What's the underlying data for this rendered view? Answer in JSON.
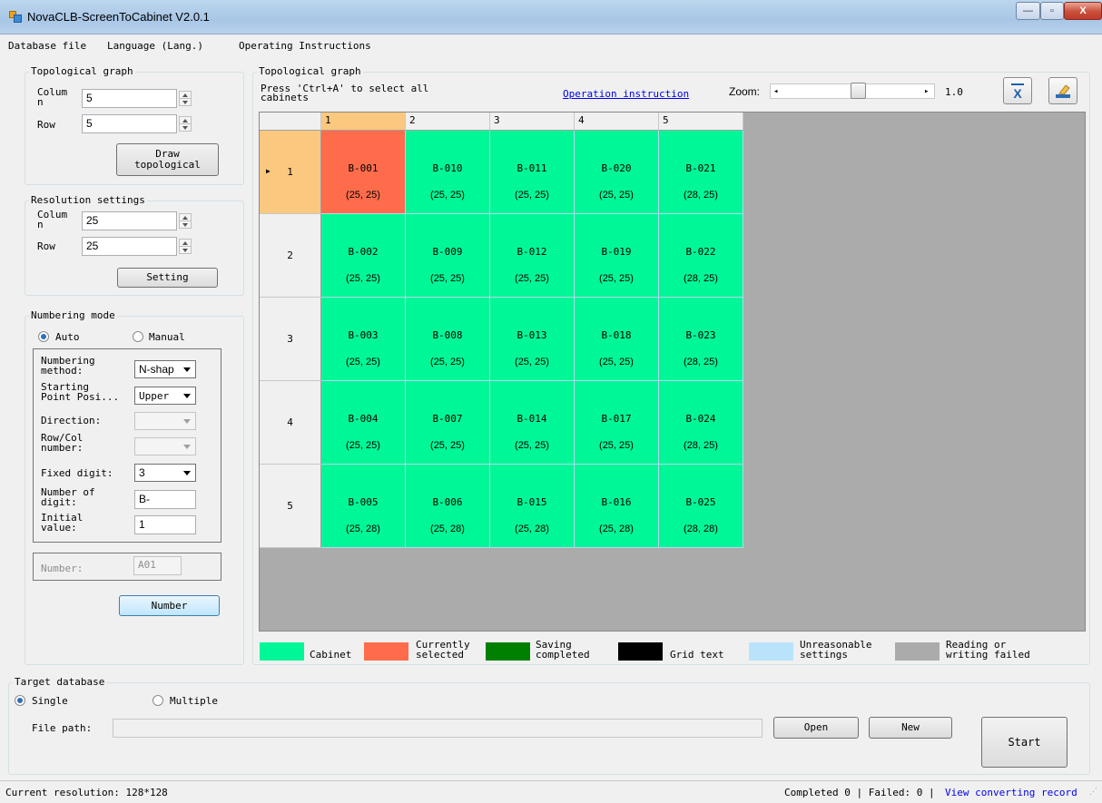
{
  "window": {
    "title": "NovaCLB-ScreenToCabinet V2.0.1",
    "controls": {
      "minimize": "—",
      "maximize": "▫",
      "close": "X"
    }
  },
  "menu": {
    "items": [
      "Database file",
      "Language (Lang.)",
      "Operating Instructions"
    ]
  },
  "topology_left": {
    "title": "Topological graph",
    "column_label": "Colum\nn",
    "column_value": "5",
    "row_label": "Row",
    "row_value": "5",
    "draw_button": "Draw\ntopological"
  },
  "resolution": {
    "title": "Resolution settings",
    "column_label": "Colum\nn",
    "column_value": "25",
    "row_label": "Row",
    "row_value": "25",
    "setting_button": "Setting"
  },
  "numbering": {
    "title": "Numbering mode",
    "auto_label": "Auto",
    "manual_label": "Manual",
    "auto_selected": true,
    "method_label": "Numbering\nmethod:",
    "method_value": "N-shap",
    "start_label": "Starting\nPoint Posi...",
    "start_value": "Upper",
    "direction_label": "Direction:",
    "direction_value": "",
    "rowcol_label": "Row/Col\nnumber:",
    "rowcol_value": "",
    "fixed_label": "Fixed digit:",
    "fixed_value": "3",
    "digit_label": "Number of\ndigit:",
    "digit_value": "B-",
    "initial_label": "Initial\nvalue:",
    "initial_value": "1",
    "number_label": "Number:",
    "number_value": "A01",
    "number_button": "Number"
  },
  "topology_main": {
    "title": "Topological graph",
    "hint": "Press 'Ctrl+A' to select all\ncabinets",
    "instruction_link": "Operation instruction",
    "zoom_label": "Zoom:",
    "zoom_value": "1.0",
    "zoom_level": 0.5,
    "tool_icons": [
      "clear-icon",
      "eraser-icon"
    ]
  },
  "grid": {
    "columns": [
      "1",
      "2",
      "3",
      "4",
      "5"
    ],
    "rows": [
      "1",
      "2",
      "3",
      "4",
      "5"
    ],
    "selected_cell": [
      0,
      0
    ],
    "cells": [
      [
        {
          "id": "B-001",
          "res": "(25, 25)"
        },
        {
          "id": "B-010",
          "res": "(25, 25)"
        },
        {
          "id": "B-011",
          "res": "(25, 25)"
        },
        {
          "id": "B-020",
          "res": "(25, 25)"
        },
        {
          "id": "B-021",
          "res": "(28, 25)"
        }
      ],
      [
        {
          "id": "B-002",
          "res": "(25, 25)"
        },
        {
          "id": "B-009",
          "res": "(25, 25)"
        },
        {
          "id": "B-012",
          "res": "(25, 25)"
        },
        {
          "id": "B-019",
          "res": "(25, 25)"
        },
        {
          "id": "B-022",
          "res": "(28, 25)"
        }
      ],
      [
        {
          "id": "B-003",
          "res": "(25, 25)"
        },
        {
          "id": "B-008",
          "res": "(25, 25)"
        },
        {
          "id": "B-013",
          "res": "(25, 25)"
        },
        {
          "id": "B-018",
          "res": "(25, 25)"
        },
        {
          "id": "B-023",
          "res": "(28, 25)"
        }
      ],
      [
        {
          "id": "B-004",
          "res": "(25, 25)"
        },
        {
          "id": "B-007",
          "res": "(25, 25)"
        },
        {
          "id": "B-014",
          "res": "(25, 25)"
        },
        {
          "id": "B-017",
          "res": "(25, 25)"
        },
        {
          "id": "B-024",
          "res": "(28, 25)"
        }
      ],
      [
        {
          "id": "B-005",
          "res": "(25, 28)"
        },
        {
          "id": "B-006",
          "res": "(25, 28)"
        },
        {
          "id": "B-015",
          "res": "(25, 28)"
        },
        {
          "id": "B-016",
          "res": "(25, 28)"
        },
        {
          "id": "B-025",
          "res": "(28, 28)"
        }
      ]
    ]
  },
  "legend": [
    {
      "label": "Cabinet",
      "color": "#00f797"
    },
    {
      "label": "Currently\nselected",
      "color": "#fe6c4c"
    },
    {
      "label": "Saving\ncompleted",
      "color": "#008000"
    },
    {
      "label": "Grid text",
      "color": "#000000"
    },
    {
      "label": "Unreasonable\nsettings",
      "color": "#b9e3fb"
    },
    {
      "label": "Reading or\nwriting failed",
      "color": "#ababab"
    }
  ],
  "target": {
    "title": "Target database",
    "single_label": "Single",
    "multiple_label": "Multiple",
    "single_selected": true,
    "file_path_label": "File path:",
    "file_path_value": "",
    "open_button": "Open",
    "new_button": "New",
    "start_button": "Start"
  },
  "status": {
    "resolution": "Current resolution: 128*128",
    "summary": "Completed 0 | Failed: 0 |",
    "record_link": "View converting record"
  },
  "colors": {
    "cabinet": "#00f797",
    "selected": "#fe6c4c",
    "header_selected": "#fbc880",
    "grid_bg": "#ababab"
  }
}
